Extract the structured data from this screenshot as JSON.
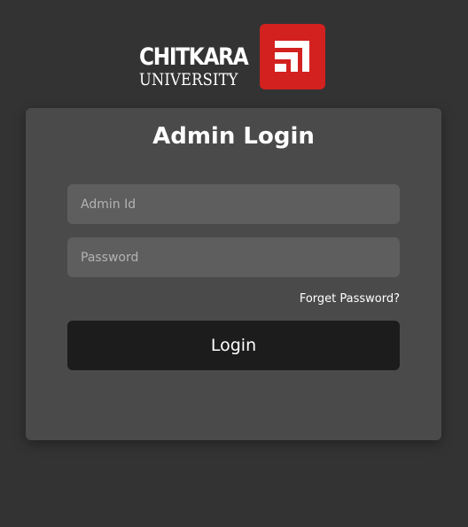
{
  "logo": {
    "main_text": "CHITKARA",
    "sub_text": "UNIVERSITY",
    "mark_icon": "chitkara-emblem",
    "brand_color": "#d2211f"
  },
  "login": {
    "title": "Admin Login",
    "admin_id_placeholder": "Admin Id",
    "admin_id_value": "",
    "password_placeholder": "Password",
    "password_value": "",
    "forgot_label": "Forget Password?",
    "submit_label": "Login"
  },
  "colors": {
    "background": "#333333",
    "card": "#4a4a4a",
    "input": "#5e5e5e",
    "button": "#1c1c1c"
  }
}
